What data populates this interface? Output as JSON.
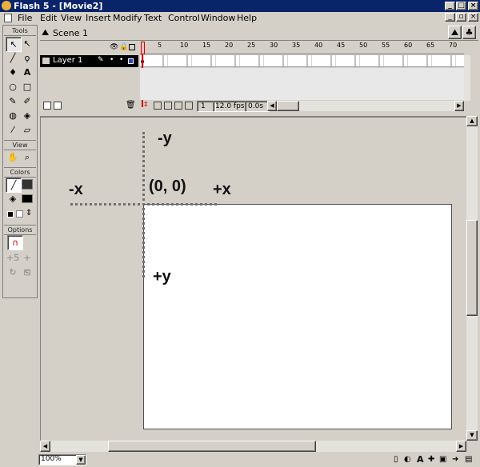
{
  "window": {
    "title": "Flash 5 - [Movie2]"
  },
  "menu": {
    "file": "File",
    "edit": "Edit",
    "view": "View",
    "insert": "Insert",
    "modify": "Modify",
    "text": "Text",
    "control": "Control",
    "window": "Window",
    "help": "Help"
  },
  "scene": {
    "name": "Scene 1"
  },
  "tools": {
    "section_tools": "Tools",
    "section_view": "View",
    "section_colors": "Colors",
    "section_options": "Options"
  },
  "timeline": {
    "layer_name": "Layer 1",
    "ruler_marks": [
      "5",
      "10",
      "15",
      "20",
      "25",
      "30",
      "35",
      "40",
      "45",
      "50",
      "55",
      "60",
      "65",
      "70"
    ],
    "current_frame": "1",
    "fps": "12.0 fps",
    "elapsed": "0.0s"
  },
  "stage": {
    "label_neg_y": "-y",
    "label_neg_x": "-x",
    "label_origin": "(0, 0)",
    "label_pos_x": "+x",
    "label_pos_y": "+y"
  },
  "status": {
    "zoom": "100%"
  }
}
